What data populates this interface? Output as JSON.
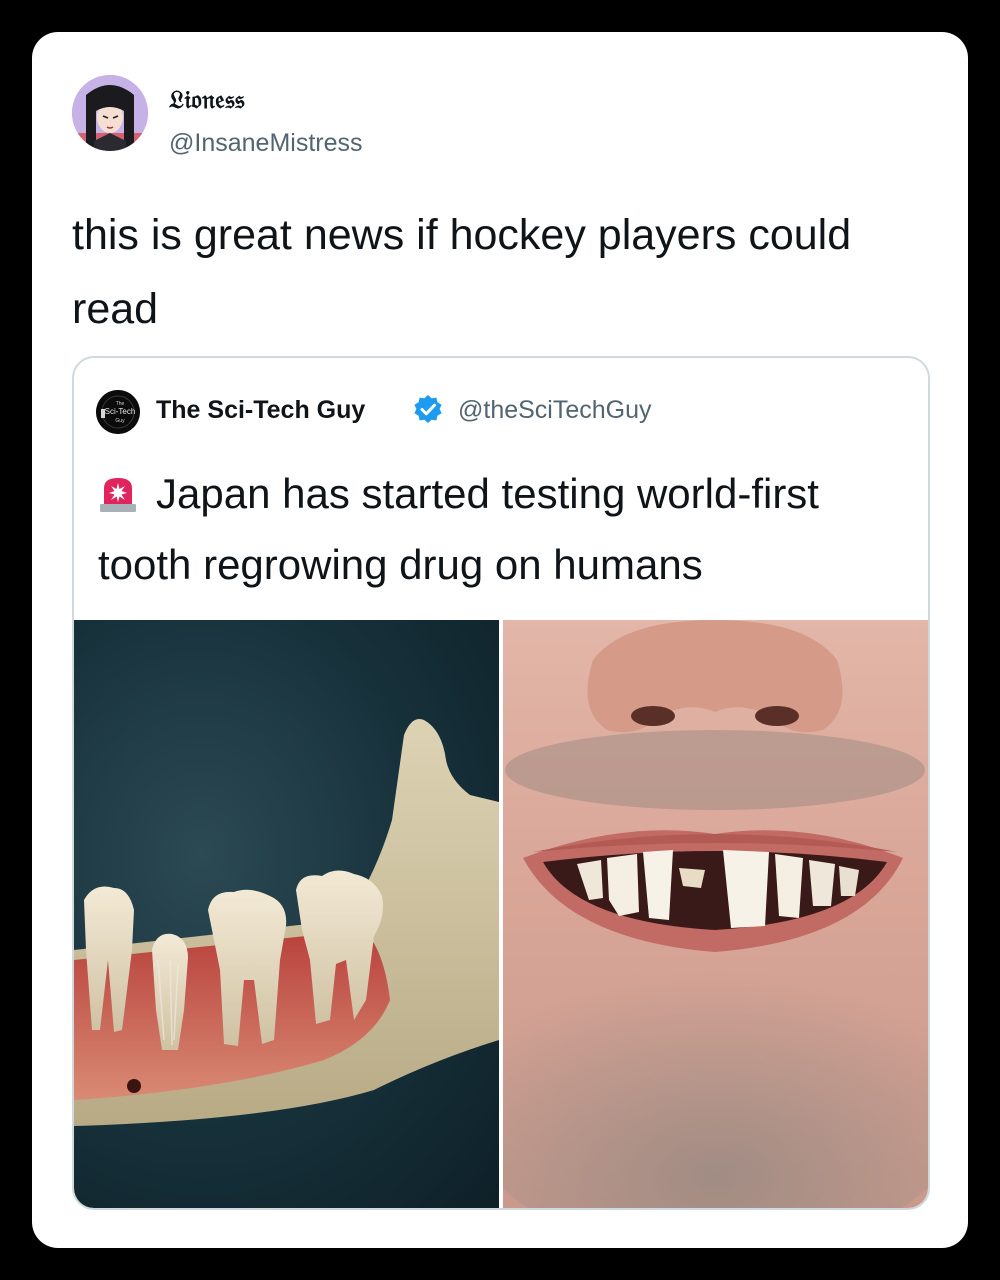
{
  "tweet": {
    "author": {
      "display_name": "𝔏𝔦𝔬𝔫𝔢𝔰𝔰",
      "handle": "@InsaneMistress",
      "avatar_icon": "anime-girl-avatar"
    },
    "text": "this is great news if hockey players could read",
    "quoted_tweet": {
      "author": {
        "display_name": "The Sci-Tech Guy",
        "handle": "@theSciTechGuy",
        "verified": true,
        "avatar_icon": "sci-tech-guy-logo",
        "avatar_lettering": "The Sci-Tech Guy"
      },
      "emoji": "rotating-light-icon",
      "text": "Japan has started testing world-first tooth regrowing drug on humans",
      "media": [
        {
          "kind": "image",
          "subject": "jawbone-with-regrowing-tooth"
        },
        {
          "kind": "image",
          "subject": "smiling-man-missing-tooth"
        }
      ]
    }
  },
  "colors": {
    "background": "#000000",
    "card": "#ffffff",
    "text_primary": "#0f1419",
    "text_secondary": "#536471",
    "border": "#cfd9de",
    "verified": "#1d9bf0",
    "siren": "#e0245e"
  }
}
